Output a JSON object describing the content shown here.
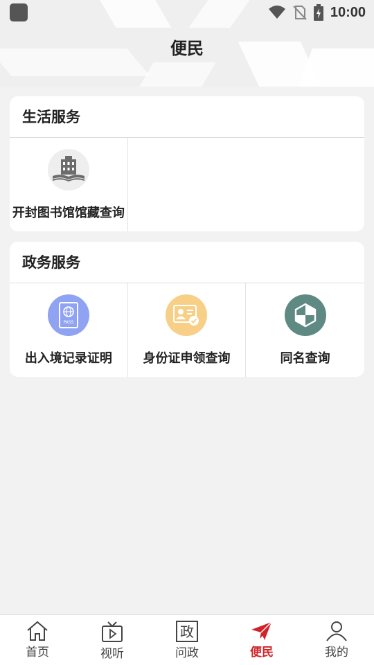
{
  "status": {
    "time": "10:00"
  },
  "page": {
    "title": "便民"
  },
  "sections": [
    {
      "title": "生活服务",
      "items": [
        {
          "label": "开封图书馆馆藏查询",
          "icon": "library-icon"
        }
      ]
    },
    {
      "title": "政务服务",
      "items": [
        {
          "label": "出入境记录证明",
          "icon": "passport-icon"
        },
        {
          "label": "身份证申领查询",
          "icon": "id-card-icon"
        },
        {
          "label": "同名查询",
          "icon": "shield-icon"
        }
      ]
    }
  ],
  "tabs": [
    {
      "label": "首页",
      "icon": "home-icon"
    },
    {
      "label": "视听",
      "icon": "tv-icon"
    },
    {
      "label": "问政",
      "icon": "zheng-icon",
      "glyph": "政"
    },
    {
      "label": "便民",
      "icon": "paper-plane-icon",
      "active": true
    },
    {
      "label": "我的",
      "icon": "user-icon"
    }
  ],
  "colors": {
    "active": "#d1242a",
    "passport": "#8fa3f2",
    "idcard": "#f8cf87",
    "shield": "#5f8a84"
  }
}
